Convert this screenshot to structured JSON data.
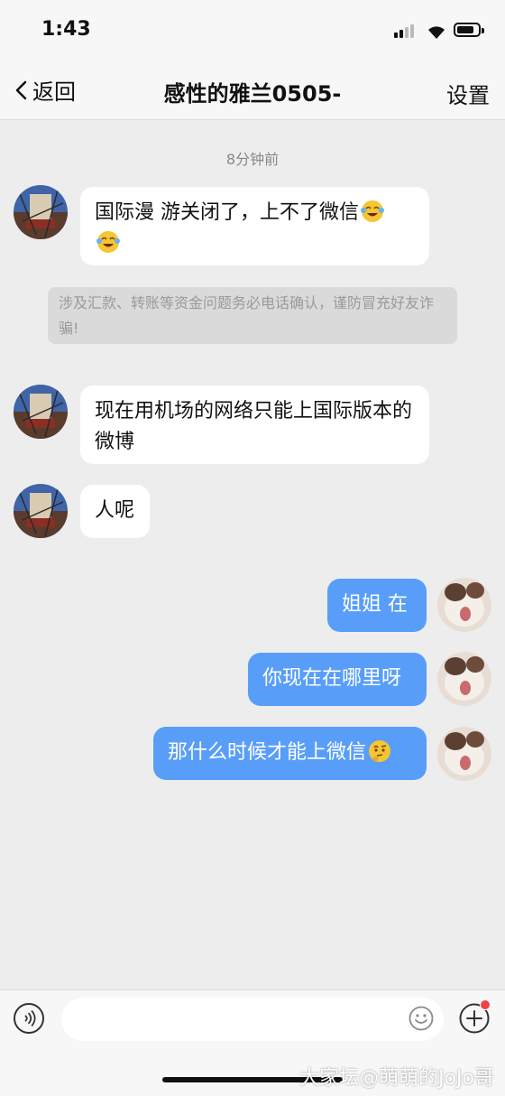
{
  "status": {
    "time": "1:43"
  },
  "nav": {
    "back_label": "返回",
    "title": "感性的雅兰0505-",
    "settings_label": "设置"
  },
  "chat": {
    "timestamp": "8分钟前",
    "notice": "涉及汇款、转账等资金问题务必电话确认，谨防冒充好友诈骗!",
    "messages": [
      {
        "text": "国际漫 游关闭了，上不了微信",
        "emoji": "laughing-crying"
      },
      {
        "text": "现在用机场的网络只能上国际版本的微博"
      },
      {
        "text": "人呢"
      },
      {
        "text": "姐姐 在"
      },
      {
        "text": "你现在在哪里呀"
      },
      {
        "text": "那什么时候才能上微信",
        "emoji": "thinking"
      }
    ]
  },
  "input": {
    "placeholder": ""
  },
  "watermark": "大家坛@萌萌的JoJo哥",
  "colors": {
    "outgoing_bubble": "#589ef9",
    "incoming_bubble": "#ffffff",
    "background": "#ededed"
  }
}
